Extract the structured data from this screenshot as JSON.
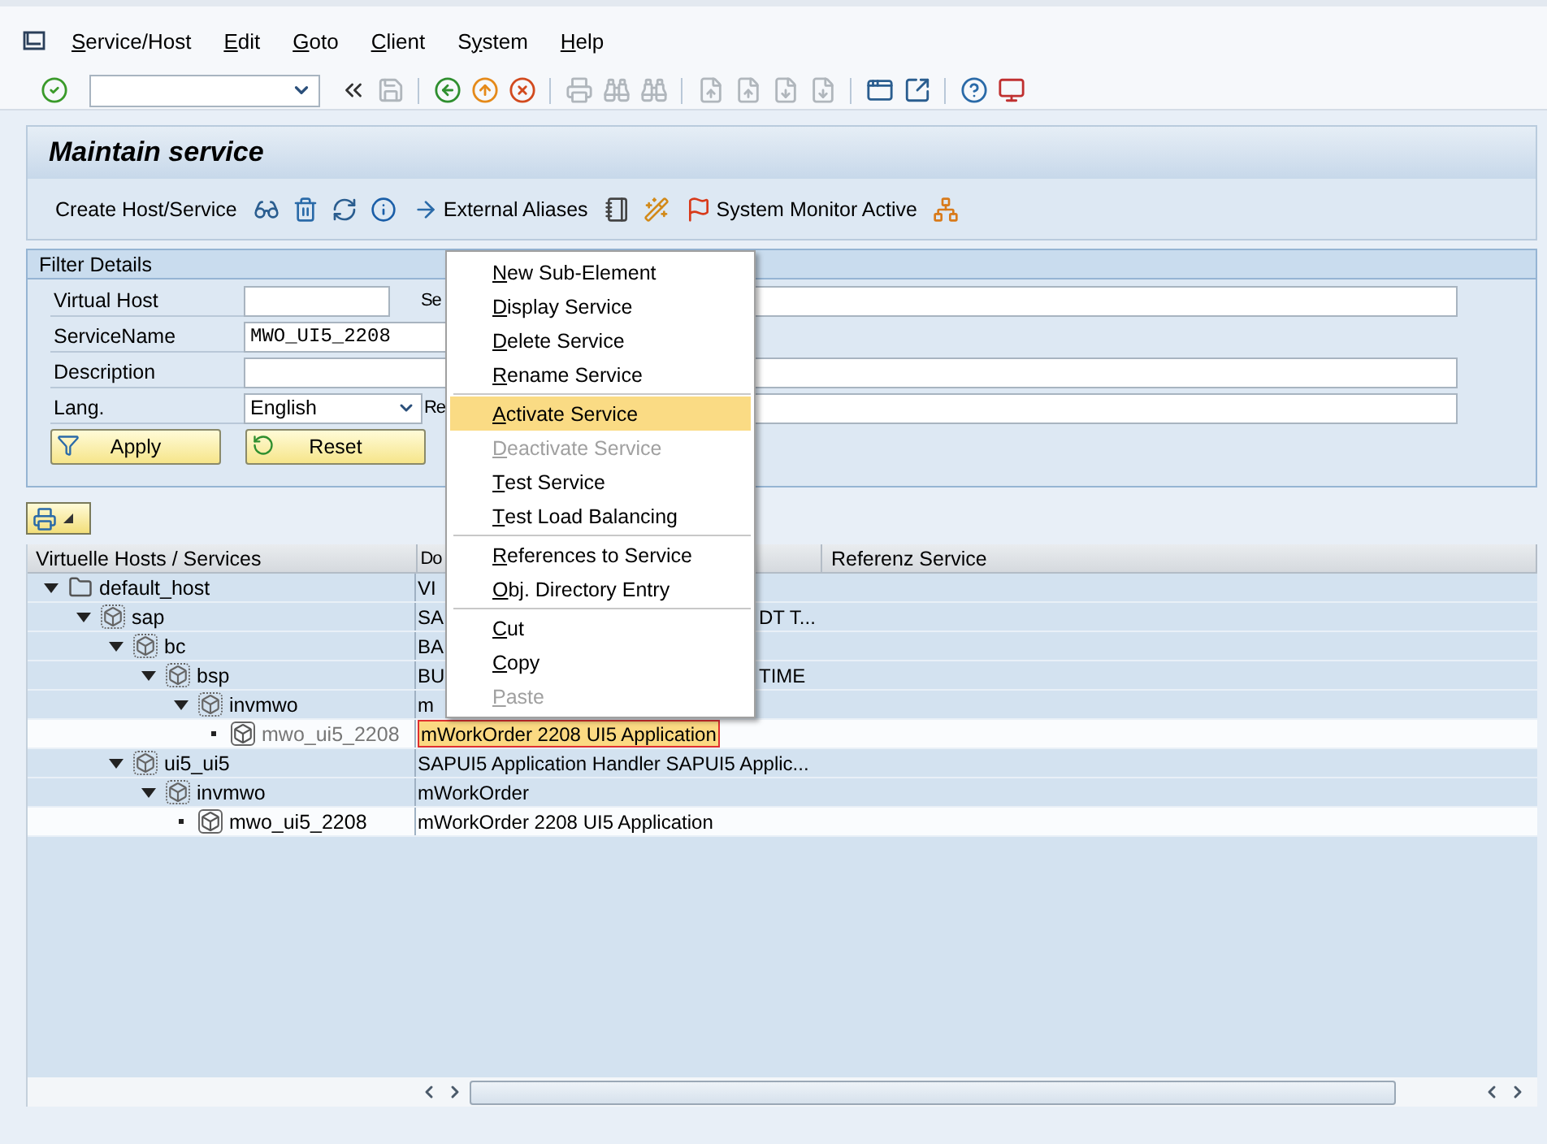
{
  "menu_bar": {
    "items": [
      {
        "key": "S",
        "rest": "ervice/Host"
      },
      {
        "key": "E",
        "rest": "dit"
      },
      {
        "key": "G",
        "rest": "oto"
      },
      {
        "key": "C",
        "rest": "lient"
      },
      {
        "before": "S",
        "key": "y",
        "rest": "stem"
      },
      {
        "key": "H",
        "rest": "elp"
      }
    ]
  },
  "toolbar": {
    "items": [
      {
        "kind": "button",
        "disabled": false
      },
      {
        "kind": "command_field"
      },
      {
        "kind": "button",
        "disabled": false
      },
      {
        "kind": "button",
        "disabled": true
      },
      {
        "kind": "separator"
      },
      {
        "kind": "button",
        "disabled": false
      },
      {
        "kind": "button",
        "disabled": false
      },
      {
        "kind": "button",
        "disabled": false
      },
      {
        "kind": "separator"
      },
      {
        "kind": "button",
        "disabled": true
      },
      {
        "kind": "button",
        "disabled": true
      },
      {
        "kind": "button",
        "disabled": true
      },
      {
        "kind": "separator"
      },
      {
        "kind": "button",
        "disabled": true
      },
      {
        "kind": "button",
        "disabled": true
      },
      {
        "kind": "button",
        "disabled": true
      },
      {
        "kind": "button",
        "disabled": true
      },
      {
        "kind": "separator"
      },
      {
        "kind": "button",
        "disabled": false
      },
      {
        "kind": "button",
        "disabled": false
      },
      {
        "kind": "separator"
      },
      {
        "kind": "button",
        "disabled": false
      },
      {
        "kind": "button",
        "disabled": false
      }
    ]
  },
  "title": "Maintain service",
  "app_toolbar": [
    {
      "kind": "text",
      "label": "Create Host/Service"
    },
    {
      "kind": "icon"
    },
    {
      "kind": "icon"
    },
    {
      "kind": "icon"
    },
    {
      "kind": "icon"
    },
    {
      "kind": "icon_text",
      "label": "External Aliases"
    },
    {
      "kind": "icon"
    },
    {
      "kind": "icon"
    },
    {
      "kind": "icon_text",
      "label": "System Monitor Active"
    },
    {
      "kind": "icon"
    }
  ],
  "filter": {
    "title": "Filter Details",
    "rows": [
      {
        "label": "Virtual Host",
        "field": {
          "kind": "text"
        },
        "right_label": "Se"
      },
      {
        "label": "ServiceName",
        "field": {
          "kind": "mono",
          "value": "MWO_UI5_2208"
        }
      },
      {
        "label": "Description",
        "field": {
          "kind": "text"
        }
      },
      {
        "label": "Lang.",
        "field": {
          "kind": "dropdown",
          "value": "English"
        },
        "right_label": "Re"
      }
    ],
    "buttons": [
      {
        "label": "Apply"
      },
      {
        "label": "Reset"
      }
    ]
  },
  "table": {
    "columns": [
      "Virtuelle Hosts / Services",
      "Do",
      "Referenz Service"
    ],
    "rows": [
      {
        "name": "default_host",
        "kind": "host",
        "expanded": true,
        "selected": false,
        "description": "VI",
        "children": [
          {
            "name": "sap",
            "kind": "node",
            "expanded": true,
            "selected": false,
            "description": "SA",
            "description_end": "DT T...",
            "children": [
              {
                "name": "bc",
                "kind": "node",
                "expanded": true,
                "selected": false,
                "description": "BA",
                "children": [
                  {
                    "name": "bsp",
                    "kind": "node",
                    "expanded": true,
                    "selected": false,
                    "description": "BU",
                    "description_end": "TIME",
                    "children": [
                      {
                        "name": "invmwo",
                        "kind": "node",
                        "expanded": true,
                        "selected": false,
                        "description": "m",
                        "children": [
                          {
                            "name": "mwo_ui5_2208",
                            "kind": "service",
                            "selected": true,
                            "description": "mWorkOrder 2208 UI5 Application"
                          }
                        ]
                      }
                    ]
                  }
                ]
              },
              {
                "name": "ui5_ui5",
                "kind": "node",
                "expanded": true,
                "selected": false,
                "description": "SAPUI5 Application Handler SAPUI5 Applic...",
                "children": [
                  {
                    "name": "invmwo",
                    "kind": "node",
                    "expanded": true,
                    "selected": false,
                    "description": "mWorkOrder",
                    "children": [
                      {
                        "name": "mwo_ui5_2208",
                        "kind": "service",
                        "selected": false,
                        "description": "mWorkOrder 2208 UI5 Application"
                      }
                    ]
                  }
                ]
              }
            ]
          }
        ]
      }
    ]
  },
  "context_menu": {
    "items": [
      {
        "kind": "item",
        "key": "N",
        "rest": "ew Sub-Element",
        "disabled": false,
        "selected": false
      },
      {
        "kind": "item",
        "key": "D",
        "rest": "isplay Service",
        "disabled": false,
        "selected": false
      },
      {
        "kind": "item",
        "key": "D",
        "rest": "elete Service",
        "disabled": false,
        "selected": false
      },
      {
        "kind": "item",
        "key": "R",
        "rest": "ename Service",
        "disabled": false,
        "selected": false
      },
      {
        "kind": "separator"
      },
      {
        "kind": "item",
        "key": "A",
        "rest": "ctivate Service",
        "disabled": false,
        "selected": true
      },
      {
        "kind": "item",
        "key": "D",
        "rest": "eactivate Service",
        "disabled": true,
        "selected": false
      },
      {
        "kind": "item",
        "key": "T",
        "rest": "est Service",
        "disabled": false,
        "selected": false
      },
      {
        "kind": "item",
        "key": "T",
        "rest": "est Load Balancing",
        "disabled": false,
        "selected": false
      },
      {
        "kind": "separator"
      },
      {
        "kind": "item",
        "key": "R",
        "rest": "eferences to Service",
        "disabled": false,
        "selected": false
      },
      {
        "kind": "item",
        "key": "O",
        "rest": "bj. Directory Entry",
        "disabled": false,
        "selected": false
      },
      {
        "kind": "separator"
      },
      {
        "kind": "item",
        "key": "C",
        "rest": "ut",
        "disabled": false,
        "selected": false
      },
      {
        "kind": "item",
        "key": "C",
        "rest": "opy",
        "disabled": false,
        "selected": false
      },
      {
        "kind": "item",
        "key": "P",
        "rest": "aste",
        "disabled": true,
        "selected": false
      }
    ]
  }
}
